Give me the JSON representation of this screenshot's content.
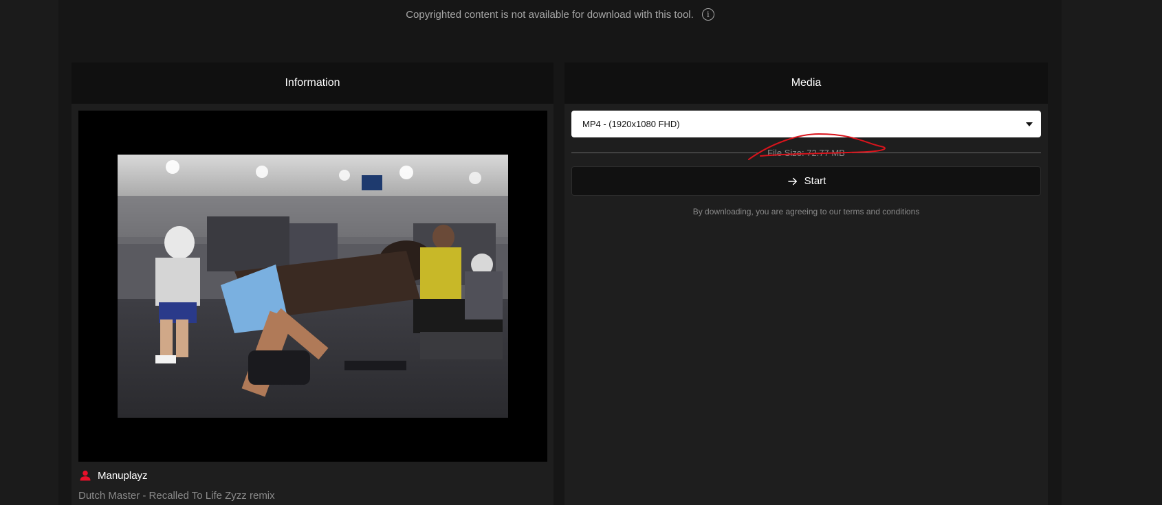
{
  "notice": {
    "text": "Copyrighted content is not available for download with this tool.",
    "icon": "info-icon"
  },
  "information": {
    "header": "Information",
    "video": {
      "thumbnail": "gym-workout-video-thumbnail"
    },
    "author": {
      "icon": "person-icon",
      "name": "Manuplayz"
    },
    "title": "Dutch Master - Recalled To Life Zyzz remix"
  },
  "media": {
    "header": "Media",
    "format_select": {
      "selected": "MP4 - (1920x1080 FHD)",
      "icon": "caret-down-icon"
    },
    "file_size": "File Size: 72.77 MB",
    "start_button": {
      "label": "Start",
      "icon": "arrow-right-icon"
    },
    "terms": "By downloading, you are agreeing to our terms and conditions"
  },
  "colors": {
    "background": "#1b1b1b",
    "panel": "#1e1e1e",
    "panel_header": "#101010",
    "accent_red": "#e8102a",
    "annotation_red": "#d8141c"
  }
}
